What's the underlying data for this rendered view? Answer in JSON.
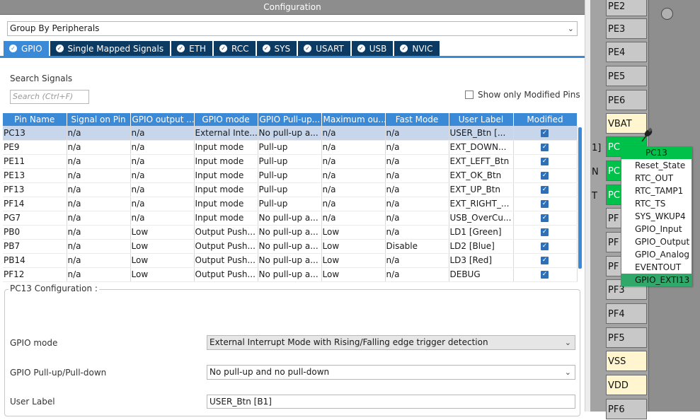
{
  "title": "Configuration",
  "group_by": "Group By Peripherals",
  "tabs": [
    {
      "label": "GPIO",
      "active": true
    },
    {
      "label": "Single Mapped Signals",
      "active": false
    },
    {
      "label": "ETH",
      "active": false
    },
    {
      "label": "RCC",
      "active": false
    },
    {
      "label": "SYS",
      "active": false
    },
    {
      "label": "USART",
      "active": false
    },
    {
      "label": "USB",
      "active": false
    },
    {
      "label": "NVIC",
      "active": false
    }
  ],
  "search": {
    "label": "Search Signals",
    "placeholder": "Search (Ctrl+F)"
  },
  "show_modified": "Show only Modified Pins",
  "table": {
    "headers": [
      "Pin Name",
      "Signal on Pin",
      "GPIO output ...",
      "GPIO mode",
      "GPIO Pull-up...",
      "Maximum ou...",
      "Fast Mode",
      "User Label",
      "Modified"
    ],
    "rows": [
      [
        "PC13",
        "n/a",
        "n/a",
        "External Inte...",
        "No pull-up a...",
        "n/a",
        "n/a",
        "USER_Btn [..."
      ],
      [
        "PE9",
        "n/a",
        "n/a",
        "Input mode",
        "Pull-up",
        "n/a",
        "n/a",
        "EXT_DOWN..."
      ],
      [
        "PE11",
        "n/a",
        "n/a",
        "Input mode",
        "Pull-up",
        "n/a",
        "n/a",
        "EXT_LEFT_Btn"
      ],
      [
        "PE13",
        "n/a",
        "n/a",
        "Input mode",
        "Pull-up",
        "n/a",
        "n/a",
        "EXT_OK_Btn"
      ],
      [
        "PF13",
        "n/a",
        "n/a",
        "Input mode",
        "Pull-up",
        "n/a",
        "n/a",
        "EXT_UP_Btn"
      ],
      [
        "PF14",
        "n/a",
        "n/a",
        "Input mode",
        "Pull-up",
        "n/a",
        "n/a",
        "EXT_RIGHT_..."
      ],
      [
        "PG7",
        "n/a",
        "n/a",
        "Input mode",
        "No pull-up a...",
        "n/a",
        "n/a",
        "USB_OverCu..."
      ],
      [
        "PB0",
        "n/a",
        "Low",
        "Output Push...",
        "No pull-up a...",
        "Low",
        "n/a",
        "LD1 [Green]"
      ],
      [
        "PB7",
        "n/a",
        "Low",
        "Output Push...",
        "No pull-up a...",
        "Low",
        "Disable",
        "LD2 [Blue]"
      ],
      [
        "PB14",
        "n/a",
        "Low",
        "Output Push...",
        "No pull-up a...",
        "Low",
        "n/a",
        "LD3 [Red]"
      ],
      [
        "PF12",
        "n/a",
        "Low",
        "Output Push...",
        "No pull-up a...",
        "Low",
        "n/a",
        "DEBUG"
      ]
    ]
  },
  "config": {
    "legend": "PC13 Configuration :",
    "gpio_mode_label": "GPIO mode",
    "gpio_mode_value": "External Interrupt Mode with Rising/Falling edge trigger detection",
    "pull_label": "GPIO Pull-up/Pull-down",
    "pull_value": "No pull-up and no pull-down",
    "user_label_label": "User Label",
    "user_label_value": "USER_Btn [B1]"
  },
  "pins": [
    "PE2",
    "PE3",
    "PE4",
    "PE5",
    "PE6",
    "VBAT",
    "PC",
    "PC",
    "PC",
    "PF",
    "PF",
    "PF",
    "PF3",
    "PF4",
    "PF5",
    "VSS",
    "VDD",
    "PF6"
  ],
  "side_chars": [
    "1]",
    "N",
    "T"
  ],
  "popup": {
    "title": "PC13",
    "items": [
      "Reset_State",
      "RTC_OUT",
      "RTC_TAMP1",
      "RTC_TS",
      "SYS_WKUP4",
      "GPIO_Input",
      "GPIO_Output",
      "GPIO_Analog",
      "EVENTOUT",
      "GPIO_EXTI13"
    ],
    "selected": "GPIO_EXTI13"
  },
  "colors": {
    "accent": "#3b8ad8",
    "tab_dark": "#0b3a63",
    "pin_green": "#00c24a",
    "pin_yellow": "#fff5cf"
  }
}
